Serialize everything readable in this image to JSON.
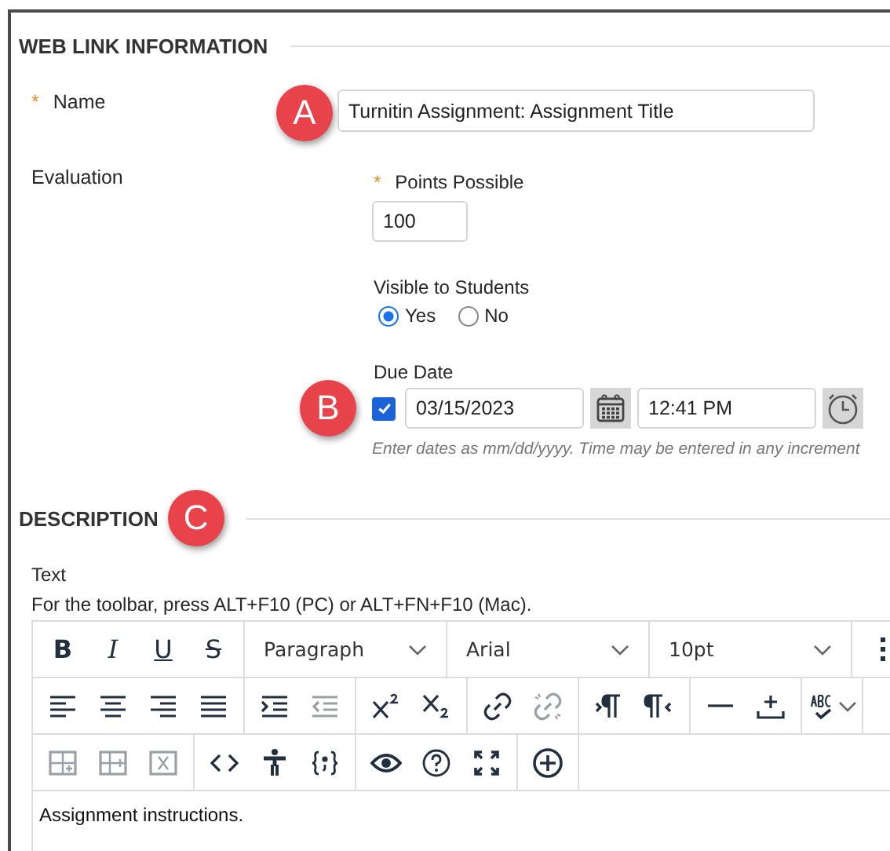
{
  "web_link_information": {
    "heading": "WEB LINK INFORMATION",
    "name": {
      "label": "Name",
      "required_mark": "*",
      "badge": "A",
      "value": "Turnitin Assignment: Assignment Title"
    },
    "evaluation": {
      "label": "Evaluation",
      "points_possible": {
        "label": "Points Possible",
        "required_mark": "*",
        "value": "100"
      },
      "visible_to_students": {
        "label": "Visible to Students",
        "options": [
          {
            "label": "Yes",
            "selected": true
          },
          {
            "label": "No",
            "selected": false
          }
        ]
      },
      "due_date": {
        "label": "Due Date",
        "badge": "B",
        "checked": true,
        "date": "03/15/2023",
        "time": "12:41 PM",
        "hint": "Enter dates as mm/dd/yyyy. Time may be entered in any increment"
      }
    }
  },
  "description": {
    "heading": "DESCRIPTION",
    "badge": "C",
    "text_label": "Text",
    "toolbar_hint": "For the toolbar, press ALT+F10 (PC) or ALT+FN+F10 (Mac).",
    "toolbar_rows": [
      [
        {
          "items": [
            {
              "kind": "bold",
              "label": "B",
              "disabled": false
            },
            {
              "kind": "italic",
              "label": "I",
              "disabled": false
            },
            {
              "kind": "underline",
              "label": "U",
              "disabled": false
            },
            {
              "kind": "strikethrough",
              "label": "S",
              "disabled": false
            }
          ]
        },
        {
          "kind": "dropdown",
          "value": "Paragraph"
        },
        {
          "kind": "dropdown",
          "value": "Arial"
        },
        {
          "kind": "dropdown",
          "value": "10pt"
        },
        {
          "items": [
            {
              "kind": "grip",
              "disabled": false
            }
          ]
        }
      ],
      [
        {
          "items": [
            {
              "kind": "align-left",
              "disabled": false
            },
            {
              "kind": "align-center",
              "disabled": false
            },
            {
              "kind": "align-right",
              "disabled": false
            },
            {
              "kind": "justify",
              "disabled": false
            }
          ]
        },
        {
          "items": [
            {
              "kind": "indent",
              "disabled": false
            },
            {
              "kind": "outdent",
              "disabled": true
            }
          ]
        },
        {
          "items": [
            {
              "kind": "superscript",
              "disabled": false
            },
            {
              "kind": "subscript",
              "disabled": false
            }
          ]
        },
        {
          "items": [
            {
              "kind": "link",
              "disabled": false
            },
            {
              "kind": "unlink",
              "disabled": true
            }
          ]
        },
        {
          "items": [
            {
              "kind": "ltr",
              "disabled": false
            },
            {
              "kind": "rtl",
              "disabled": false
            }
          ]
        },
        {
          "items": [
            {
              "kind": "horizontal-rule",
              "disabled": false
            },
            {
              "kind": "insert-below",
              "disabled": false
            }
          ]
        },
        {
          "items": [
            {
              "kind": "spellcheck",
              "disabled": false
            }
          ]
        }
      ],
      [
        {
          "items": [
            {
              "kind": "table-row",
              "disabled": true
            },
            {
              "kind": "table-column",
              "disabled": true
            },
            {
              "kind": "table-delete",
              "disabled": true
            }
          ]
        },
        {
          "items": [
            {
              "kind": "code",
              "disabled": false
            },
            {
              "kind": "accessibility",
              "disabled": false
            },
            {
              "kind": "braces",
              "disabled": false
            }
          ]
        },
        {
          "items": [
            {
              "kind": "preview",
              "disabled": false
            },
            {
              "kind": "help",
              "disabled": false
            },
            {
              "kind": "fullscreen",
              "disabled": false
            }
          ]
        },
        {
          "items": [
            {
              "kind": "add",
              "disabled": false
            }
          ]
        }
      ]
    ],
    "content": "Assignment instructions."
  }
}
